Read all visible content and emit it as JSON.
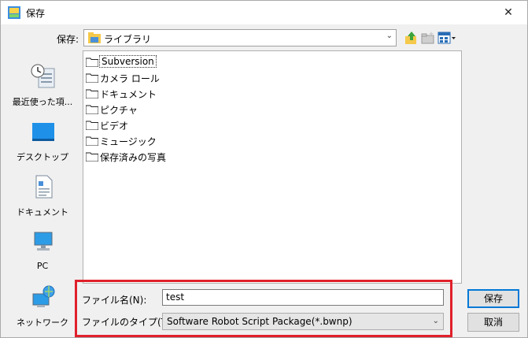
{
  "window": {
    "title": "保存",
    "close_symbol": "✕"
  },
  "toolbar": {
    "save_in_label": "保存:",
    "location": "ライブラリ",
    "icons": [
      "up-folder-icon",
      "new-folder-icon",
      "view-menu-icon"
    ]
  },
  "places": [
    {
      "label": "最近使った項...",
      "icon": "recent-places-icon"
    },
    {
      "label": "デスクトップ",
      "icon": "desktop-icon"
    },
    {
      "label": "ドキュメント",
      "icon": "documents-icon"
    },
    {
      "label": "PC",
      "icon": "pc-icon"
    },
    {
      "label": "ネットワーク",
      "icon": "network-icon"
    }
  ],
  "files": [
    {
      "name": "Subversion",
      "selected": true
    },
    {
      "name": "カメラ ロール"
    },
    {
      "name": "ドキュメント"
    },
    {
      "name": "ピクチャ"
    },
    {
      "name": "ビデオ"
    },
    {
      "name": "ミュージック"
    },
    {
      "name": "保存済みの写真"
    }
  ],
  "form": {
    "filename_label": "ファイル名(N):",
    "filename_value": "test",
    "filetype_label": "ファイルのタイプ(T):",
    "filetype_value": "Software Robot Script Package(*.bwnp)"
  },
  "buttons": {
    "save": "保存",
    "cancel": "取消"
  },
  "colors": {
    "highlight": "#e0202a",
    "primary_border": "#0078d7",
    "folder": "#f5d36b"
  }
}
